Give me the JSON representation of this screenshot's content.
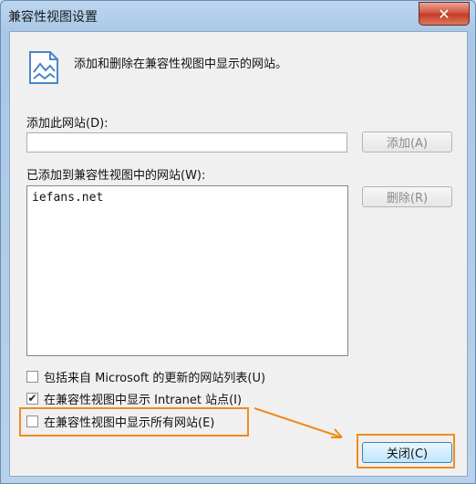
{
  "window": {
    "title": "兼容性视图设置",
    "close_glyph": "✕"
  },
  "hint": {
    "text": "添加和删除在兼容性视图中显示的网站。",
    "icon": "picture-icon"
  },
  "add_site": {
    "label": "添加此网站(D):",
    "value": "",
    "button_label": "添加(A)"
  },
  "added_sites": {
    "label": "已添加到兼容性视图中的网站(W):",
    "items": [
      "iefans.net"
    ],
    "remove_label": "删除(R)"
  },
  "options": [
    {
      "label": "包括来自 Microsoft 的更新的网站列表(U)",
      "checked": false
    },
    {
      "label": "在兼容性视图中显示 Intranet 站点(I)",
      "checked": true
    },
    {
      "label": "在兼容性视图中显示所有网站(E)",
      "checked": false
    }
  ],
  "footer": {
    "close_label": "关闭(C)"
  },
  "colors": {
    "highlight": "#f08c1c"
  }
}
